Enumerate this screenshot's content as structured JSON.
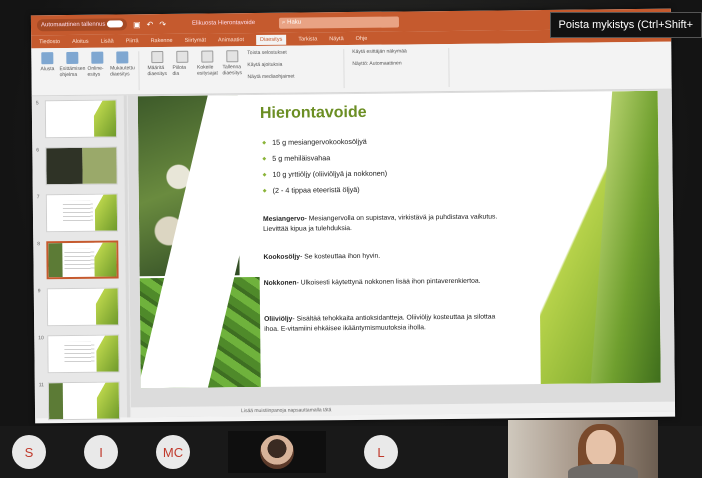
{
  "app": {
    "autosave_label": "Automaattinen tallennus",
    "autosave_state": "On",
    "doc_title": "Elikuosta Hierontavoide",
    "search_placeholder": "Haku"
  },
  "ribbon_tabs": [
    "Tiedosto",
    "Aloitus",
    "Lisää",
    "Piirrä",
    "Rakenne",
    "Siirtymät",
    "Animaatiot",
    "Diaesitys",
    "Tarkista",
    "Näytä",
    "Ohje"
  ],
  "active_tab": "Diaesitys",
  "ribbon": {
    "buttons": [
      "Alusta",
      "Esittämisen ohjelma",
      "Online-esitys",
      "Mukautettu diaesitys",
      "Määritä diaesitys",
      "Piilota dia",
      "Kokeile esitysajat",
      "Tallenna diaesitys"
    ],
    "options": [
      "Toista selostukset",
      "Käytä ajoituksia",
      "Näytä mediaohjaimet",
      "Käytä esittäjän näkymää",
      "Näyttö: Automaattinen"
    ],
    "groups": [
      "Aloita diaesitys",
      "Asetukset",
      "Näytöt"
    ]
  },
  "slide": {
    "title": "Hierontavoide",
    "bullets": [
      "15 g mesiangervokookosöljyä",
      "5 g mehiläisvahaa",
      "10 g yrttiöljy (oliiviöljyä ja nokkonen)",
      "(2 - 4 tippaa eteeristä öljyä)"
    ],
    "paragraphs": [
      {
        "term": "Mesiangervo",
        "text": "- Mesiangervolla on supistava, virkistävä ja puhdistava vaikutus. Lievittää kipua ja tulehduksia."
      },
      {
        "term": "Kookosöljy",
        "text": "- Se kosteuttaa ihon hyvin."
      },
      {
        "term": "Nokkonen",
        "text": "- Ulkoisesti käytettynä nokkonen lisää ihon pintaverenkiertoa."
      },
      {
        "term": "Oliiviöljy",
        "text": "- Sisältää tehokkaita antioksidantteja. Oliiviöljy kosteuttaa ja silottaa ihoa. E-vitamiini ehkäisee ikääntymismuutoksia iholla."
      }
    ]
  },
  "status_bar": "Lisää muistiinpanoja napsauttamalla tätä",
  "thumb_numbers": [
    "5",
    "6",
    "7",
    "8",
    "9",
    "10",
    "11"
  ],
  "tooltip": "Poista mykistys (Ctrl+Shift+",
  "participants": [
    "S",
    "I",
    "MC",
    "L"
  ]
}
